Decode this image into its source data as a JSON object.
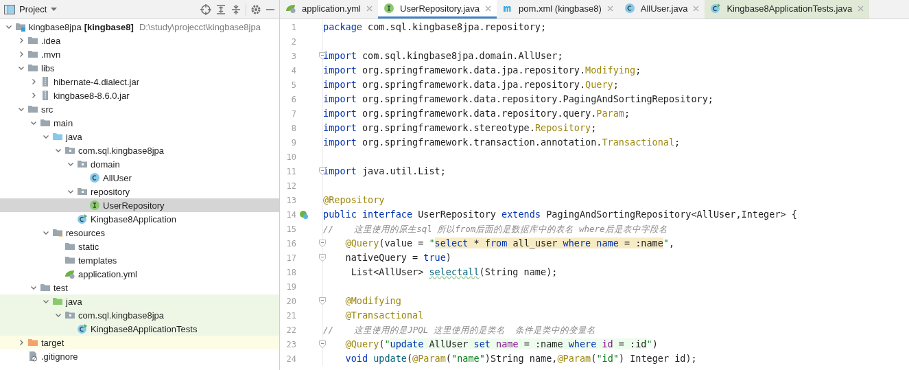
{
  "project_panel": {
    "title": "Project"
  },
  "tree": [
    {
      "label": "kingbase8jpa",
      "module": "[kingbase8]",
      "path": "D:\\study\\projecct\\kingbase8jpa",
      "kind": "module",
      "expanded": true,
      "selected": false,
      "children": [
        {
          "label": ".idea",
          "kind": "folder",
          "expanded": false,
          "selected": false
        },
        {
          "label": ".mvn",
          "kind": "folder",
          "expanded": false,
          "selected": false
        },
        {
          "label": "libs",
          "kind": "folder",
          "expanded": true,
          "selected": false,
          "children": [
            {
              "label": "hibernate-4.dialect.jar",
              "kind": "jar",
              "expanded": false,
              "selected": false
            },
            {
              "label": "kingbase8-8.6.0.jar",
              "kind": "jar",
              "expanded": false,
              "selected": false
            }
          ]
        },
        {
          "label": "src",
          "kind": "folder",
          "expanded": true,
          "selected": false,
          "children": [
            {
              "label": "main",
              "kind": "folder",
              "expanded": true,
              "selected": false,
              "children": [
                {
                  "label": "java",
                  "kind": "source-folder",
                  "expanded": true,
                  "selected": false,
                  "children": [
                    {
                      "label": "com.sql.kingbase8jpa",
                      "kind": "package",
                      "expanded": true,
                      "selected": false,
                      "children": [
                        {
                          "label": "domain",
                          "kind": "package",
                          "expanded": true,
                          "selected": false,
                          "children": [
                            {
                              "label": "AllUser",
                              "kind": "class",
                              "selected": false
                            }
                          ]
                        },
                        {
                          "label": "repository",
                          "kind": "package",
                          "expanded": true,
                          "selected": false,
                          "children": [
                            {
                              "label": "UserRepository",
                              "kind": "interface",
                              "selected": true
                            }
                          ]
                        },
                        {
                          "label": "Kingbase8Application",
                          "kind": "boot-class",
                          "selected": false
                        }
                      ]
                    }
                  ]
                },
                {
                  "label": "resources",
                  "kind": "resources",
                  "expanded": true,
                  "selected": false,
                  "children": [
                    {
                      "label": "static",
                      "kind": "folder",
                      "selected": false
                    },
                    {
                      "label": "templates",
                      "kind": "folder",
                      "selected": false
                    },
                    {
                      "label": "application.yml",
                      "kind": "yml",
                      "selected": false
                    }
                  ]
                }
              ]
            },
            {
              "label": "test",
              "kind": "folder",
              "expanded": true,
              "selected": false,
              "children": [
                {
                  "label": "java",
                  "kind": "test-folder",
                  "expanded": true,
                  "selected": false,
                  "color": "#eef7e6",
                  "children": [
                    {
                      "label": "com.sql.kingbase8jpa",
                      "kind": "package",
                      "expanded": true,
                      "selected": false,
                      "color": "#eef7e6",
                      "children": [
                        {
                          "label": "Kingbase8ApplicationTests",
                          "kind": "boot-class",
                          "selected": false,
                          "color": "#eef7e6"
                        }
                      ]
                    }
                  ]
                }
              ]
            }
          ]
        },
        {
          "label": "target",
          "kind": "excluded-folder",
          "expanded": false,
          "selected": false,
          "color": "#fdfde6"
        },
        {
          "label": ".gitignore",
          "kind": "ignore-file",
          "selected": false
        }
      ]
    }
  ],
  "tabs": [
    {
      "label": "application.yml",
      "kind": "yml",
      "selected": false
    },
    {
      "label": "UserRepository.java",
      "kind": "interface",
      "selected": true
    },
    {
      "label": "pom.xml (kingbase8)",
      "kind": "maven",
      "selected": false
    },
    {
      "label": "AllUser.java",
      "kind": "class",
      "selected": false
    },
    {
      "label": "Kingbase8ApplicationTests.java",
      "kind": "boot-class",
      "selected": false,
      "color": "#dfe9d6"
    }
  ],
  "code": [
    {
      "number": "1",
      "fold": false,
      "tokens": [
        {
          "text": "package",
          "kind": "kw"
        },
        {
          "text": " com.sql.kingbase8jpa.repository;",
          "kind": "plain"
        }
      ]
    },
    {
      "number": "2",
      "fold": false
    },
    {
      "number": "3",
      "fold": true,
      "tokens": [
        {
          "text": "import",
          "kind": "kw"
        },
        {
          "text": " com.sql.kingbase8jpa.domain.AllUser;",
          "kind": "plain"
        }
      ]
    },
    {
      "number": "4",
      "fold": false,
      "tokens": [
        {
          "text": "import",
          "kind": "kw"
        },
        {
          "text": " org.springframework.data.jpa.repository.",
          "kind": "plain"
        },
        {
          "text": "Modifying",
          "kind": "ann"
        },
        {
          "text": ";",
          "kind": "plain"
        }
      ]
    },
    {
      "number": "5",
      "fold": false,
      "tokens": [
        {
          "text": "import",
          "kind": "kw"
        },
        {
          "text": " org.springframework.data.jpa.repository.",
          "kind": "plain"
        },
        {
          "text": "Query",
          "kind": "ann"
        },
        {
          "text": ";",
          "kind": "plain"
        }
      ]
    },
    {
      "number": "6",
      "fold": false,
      "tokens": [
        {
          "text": "import",
          "kind": "kw"
        },
        {
          "text": " org.springframework.data.repository.PagingAndSortingRepository;",
          "kind": "plain"
        }
      ]
    },
    {
      "number": "7",
      "fold": false,
      "tokens": [
        {
          "text": "import",
          "kind": "kw"
        },
        {
          "text": " org.springframework.data.repository.query.",
          "kind": "plain"
        },
        {
          "text": "Param",
          "kind": "ann"
        },
        {
          "text": ";",
          "kind": "plain"
        }
      ]
    },
    {
      "number": "8",
      "fold": false,
      "tokens": [
        {
          "text": "import",
          "kind": "kw"
        },
        {
          "text": " org.springframework.stereotype.",
          "kind": "plain"
        },
        {
          "text": "Repository",
          "kind": "ann"
        },
        {
          "text": ";",
          "kind": "plain"
        }
      ]
    },
    {
      "number": "9",
      "fold": false,
      "tokens": [
        {
          "text": "import",
          "kind": "kw"
        },
        {
          "text": " org.springframework.transaction.annotation.",
          "kind": "plain"
        },
        {
          "text": "Transactional",
          "kind": "ann"
        },
        {
          "text": ";",
          "kind": "plain"
        }
      ]
    },
    {
      "number": "10",
      "fold": false
    },
    {
      "number": "11",
      "fold": true,
      "tokens": [
        {
          "text": "import",
          "kind": "kw"
        },
        {
          "text": " java.util.List;",
          "kind": "plain"
        }
      ]
    },
    {
      "number": "12",
      "fold": false
    },
    {
      "number": "13",
      "fold": false,
      "tokens": [
        {
          "text": "@Repository",
          "kind": "ann"
        }
      ]
    },
    {
      "number": "14",
      "fold": false,
      "kind": "implemented",
      "tokens": [
        {
          "text": "public",
          "kind": "kw"
        },
        {
          "text": " interface",
          "kind": "kw"
        },
        {
          "text": " UserRepository",
          "kind": "plain"
        },
        {
          "text": " extends",
          "kind": "kw"
        },
        {
          "text": " PagingAndSortingRepository<AllUser,Integer> {",
          "kind": "plain"
        }
      ]
    },
    {
      "number": "15",
      "fold": false,
      "tokens": [
        {
          "text": "//    这里使用的原生sql 所以from后面的是数据库中的表名 where后是表中字段名",
          "kind": "comment"
        }
      ]
    },
    {
      "number": "16",
      "fold": true,
      "tokens": [
        {
          "text": "    @Query",
          "kind": "ann"
        },
        {
          "text": "(value = ",
          "kind": "plain"
        },
        {
          "text": "\"",
          "kind": "str"
        },
        {
          "text": "select",
          "kind": "sql-kw"
        },
        {
          "text": " * ",
          "kind": "sql"
        },
        {
          "text": "from",
          "kind": "sql-kw"
        },
        {
          "text": " all_user ",
          "kind": "sql"
        },
        {
          "text": "where name",
          "kind": "sql-kw"
        },
        {
          "text": " = :name",
          "kind": "sql"
        },
        {
          "text": "\"",
          "kind": "str"
        },
        {
          "text": ",",
          "kind": "plain"
        }
      ]
    },
    {
      "number": "17",
      "fold": true,
      "tokens": [
        {
          "text": "    nativeQuery = ",
          "kind": "plain"
        },
        {
          "text": "true",
          "kind": "kw"
        },
        {
          "text": ")",
          "kind": "plain"
        }
      ]
    },
    {
      "number": "18",
      "fold": false,
      "tokens": [
        {
          "text": "     List<AllUser> ",
          "kind": "plain"
        },
        {
          "text": "selectall",
          "kind": "method-warn"
        },
        {
          "text": "(String name);",
          "kind": "plain"
        }
      ]
    },
    {
      "number": "19",
      "fold": false
    },
    {
      "number": "20",
      "fold": true,
      "tokens": [
        {
          "text": "    @Modifying",
          "kind": "ann"
        }
      ]
    },
    {
      "number": "21",
      "fold": false,
      "tokens": [
        {
          "text": "    @Transactional",
          "kind": "ann"
        }
      ]
    },
    {
      "number": "22",
      "fold": false,
      "tokens": [
        {
          "text": "//    这里使用的是JPQL 这里使用的是类名  条件是类中的变量名",
          "kind": "comment"
        }
      ]
    },
    {
      "number": "23",
      "fold": true,
      "tokens": [
        {
          "text": "    @Query",
          "kind": "ann"
        },
        {
          "text": "(",
          "kind": "plain"
        },
        {
          "text": "\"",
          "kind": "str"
        },
        {
          "text": "update",
          "kind": "jpql-kw"
        },
        {
          "text": " AllUser ",
          "kind": "jpql"
        },
        {
          "text": "set ",
          "kind": "jpql-kw"
        },
        {
          "text": "name",
          "kind": "jpql-field"
        },
        {
          "text": " = :name ",
          "kind": "jpql"
        },
        {
          "text": "where ",
          "kind": "jpql-kw"
        },
        {
          "text": "id",
          "kind": "jpql-field"
        },
        {
          "text": " = :id",
          "kind": "jpql"
        },
        {
          "text": "\"",
          "kind": "str"
        },
        {
          "text": ")",
          "kind": "plain"
        }
      ]
    },
    {
      "number": "24",
      "fold": false,
      "tokens": [
        {
          "text": "    void",
          "kind": "kw"
        },
        {
          "text": " update",
          "kind": "method"
        },
        {
          "text": "(",
          "kind": "plain"
        },
        {
          "text": "@Param",
          "kind": "ann"
        },
        {
          "text": "(",
          "kind": "plain"
        },
        {
          "text": "\"name\"",
          "kind": "str"
        },
        {
          "text": ")String name,",
          "kind": "plain"
        },
        {
          "text": "@Param",
          "kind": "ann"
        },
        {
          "text": "(",
          "kind": "plain"
        },
        {
          "text": "\"id\"",
          "kind": "str"
        },
        {
          "text": ") Integer id);",
          "kind": "plain"
        }
      ]
    }
  ]
}
